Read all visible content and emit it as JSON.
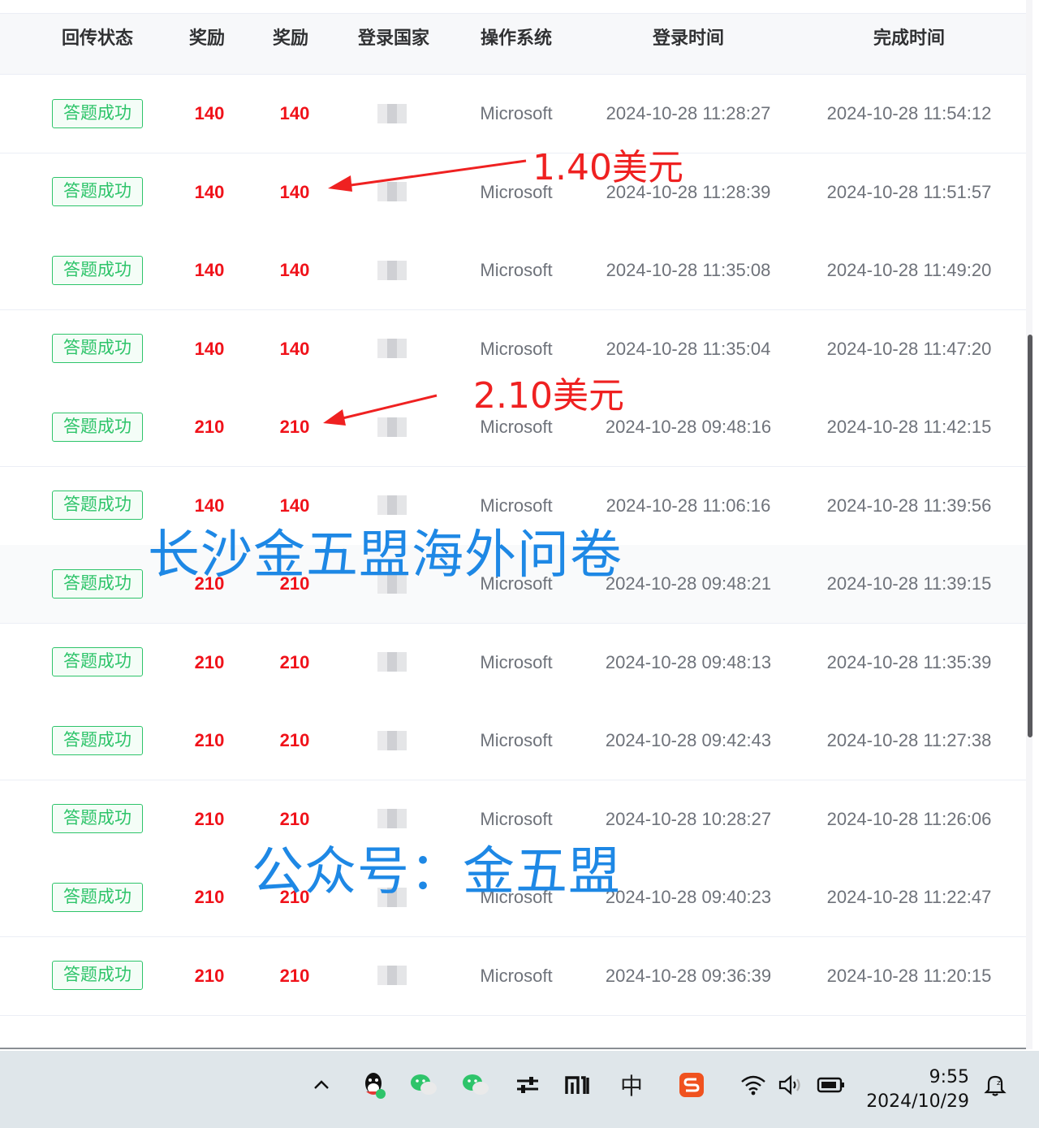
{
  "table": {
    "headers": [
      "回传状态",
      "奖励",
      "奖励",
      "登录国家",
      "操作系统",
      "登录时间",
      "完成时间"
    ],
    "rows": [
      {
        "status": "答题成功",
        "reward1": "140",
        "reward2": "140",
        "os": "Microsoft",
        "login_time": "2024-10-28 11:28:27",
        "finish_time": "2024-10-28 11:54:12"
      },
      {
        "status": "答题成功",
        "reward1": "140",
        "reward2": "140",
        "os": "Microsoft",
        "login_time": "2024-10-28 11:28:39",
        "finish_time": "2024-10-28 11:51:57"
      },
      {
        "status": "答题成功",
        "reward1": "140",
        "reward2": "140",
        "os": "Microsoft",
        "login_time": "2024-10-28 11:35:08",
        "finish_time": "2024-10-28 11:49:20"
      },
      {
        "status": "答题成功",
        "reward1": "140",
        "reward2": "140",
        "os": "Microsoft",
        "login_time": "2024-10-28 11:35:04",
        "finish_time": "2024-10-28 11:47:20"
      },
      {
        "status": "答题成功",
        "reward1": "210",
        "reward2": "210",
        "os": "Microsoft",
        "login_time": "2024-10-28 09:48:16",
        "finish_time": "2024-10-28 11:42:15"
      },
      {
        "status": "答题成功",
        "reward1": "140",
        "reward2": "140",
        "os": "Microsoft",
        "login_time": "2024-10-28 11:06:16",
        "finish_time": "2024-10-28 11:39:56"
      },
      {
        "status": "答题成功",
        "reward1": "210",
        "reward2": "210",
        "os": "Microsoft",
        "login_time": "2024-10-28 09:48:21",
        "finish_time": "2024-10-28 11:39:15"
      },
      {
        "status": "答题成功",
        "reward1": "210",
        "reward2": "210",
        "os": "Microsoft",
        "login_time": "2024-10-28 09:48:13",
        "finish_time": "2024-10-28 11:35:39"
      },
      {
        "status": "答题成功",
        "reward1": "210",
        "reward2": "210",
        "os": "Microsoft",
        "login_time": "2024-10-28 09:42:43",
        "finish_time": "2024-10-28 11:27:38"
      },
      {
        "status": "答题成功",
        "reward1": "210",
        "reward2": "210",
        "os": "Microsoft",
        "login_time": "2024-10-28 10:28:27",
        "finish_time": "2024-10-28 11:26:06"
      },
      {
        "status": "答题成功",
        "reward1": "210",
        "reward2": "210",
        "os": "Microsoft",
        "login_time": "2024-10-28 09:40:23",
        "finish_time": "2024-10-28 11:22:47"
      },
      {
        "status": "答题成功",
        "reward1": "210",
        "reward2": "210",
        "os": "Microsoft",
        "login_time": "2024-10-28 09:36:39",
        "finish_time": "2024-10-28 11:20:15"
      }
    ]
  },
  "annotations": {
    "usd_140": "1.40美元",
    "usd_210": "2.10美元",
    "watermark_name": "长沙金五盟海外问卷",
    "watermark_account": "公众号：金五盟"
  },
  "taskbar": {
    "icons": [
      "chevron-up-icon",
      "qq-icon",
      "wechat-icon",
      "wechat-icon",
      "settings-toggle-icon",
      "mi-icon",
      "ime-icon",
      "sogou-icon",
      "wifi-icon",
      "volume-icon",
      "battery-icon",
      "notification-bell-icon"
    ],
    "ime_label": "中",
    "time": "9:55",
    "date": "2024/10/29"
  },
  "colors": {
    "success_green": "#2ec46a",
    "reward_red": "#f0121a",
    "annotation_red": "#ef2121",
    "watermark_blue": "#1e88e5",
    "taskbar_bg": "#dfe6ea"
  }
}
